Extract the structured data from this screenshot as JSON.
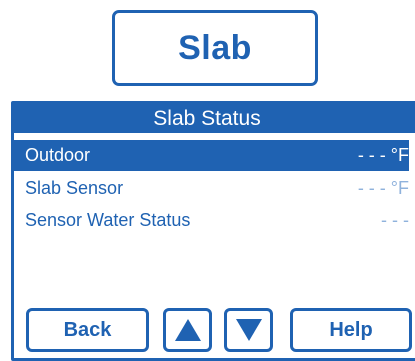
{
  "screen": {
    "title": "Slab"
  },
  "panel": {
    "header": "Slab Status",
    "rows": [
      {
        "label": "Outdoor",
        "value": "- - - °F",
        "selected": true
      },
      {
        "label": "Slab Sensor",
        "value": "- - - °F",
        "selected": false
      },
      {
        "label": "Sensor Water Status",
        "value": "- - -",
        "selected": false
      }
    ]
  },
  "buttons": {
    "back_label": "Back",
    "up_icon": "arrow-up-icon",
    "down_icon": "arrow-down-icon",
    "help_label": "Help"
  },
  "colors": {
    "accent": "#1f62b2",
    "background": "#ffffff",
    "muted_value": "#8fb2dc"
  }
}
